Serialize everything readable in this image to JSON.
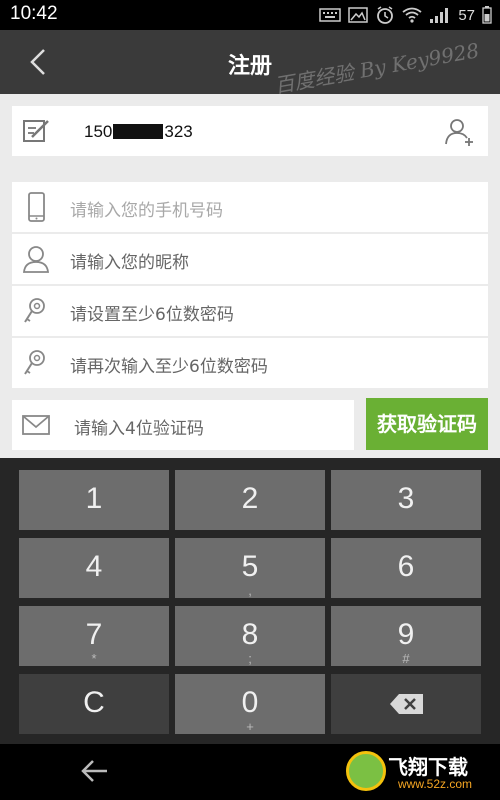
{
  "status_bar": {
    "time": "10:42",
    "battery": "57"
  },
  "header": {
    "title": "注册",
    "watermark": "百度经验 By Key9928"
  },
  "prefilled": {
    "phone_prefix": "150",
    "phone_suffix": "323"
  },
  "form": {
    "phone_placeholder": "请输入您的手机号码",
    "nickname_placeholder": "请输入您的昵称",
    "password_placeholder": "请设置至少6位数密码",
    "confirm_placeholder": "请再次输入至少6位数密码",
    "code_placeholder": "请输入4位验证码",
    "get_code_label": "获取验证码"
  },
  "keypad": {
    "keys": [
      {
        "num": "1",
        "sub": ""
      },
      {
        "num": "2",
        "sub": ""
      },
      {
        "num": "3",
        "sub": ""
      },
      {
        "num": "4",
        "sub": ""
      },
      {
        "num": "5",
        "sub": ","
      },
      {
        "num": "6",
        "sub": ""
      },
      {
        "num": "7",
        "sub": "*"
      },
      {
        "num": "8",
        "sub": ";"
      },
      {
        "num": "9",
        "sub": "#"
      },
      {
        "num": "C",
        "sub": ""
      },
      {
        "num": "0",
        "sub": "+"
      },
      {
        "num": "",
        "sub": ""
      }
    ]
  },
  "logo": {
    "name": "飞翔下载",
    "url": "www.52z.com"
  },
  "colors": {
    "accent": "#6ab034",
    "header_bg": "#3a3a3a",
    "key_bg": "#6d6d6d"
  }
}
